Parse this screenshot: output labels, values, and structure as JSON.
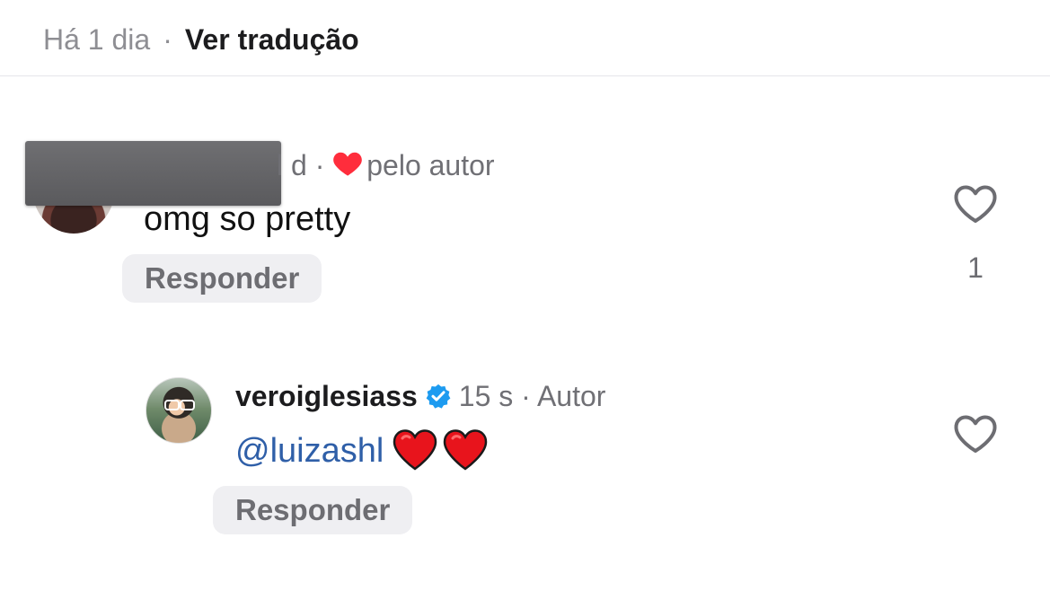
{
  "post_meta": {
    "time": "Há 1 dia",
    "separator": "·",
    "translate": "Ver tradução"
  },
  "comment1": {
    "author": "",
    "time_suffix": "l d ·",
    "liked_by_author_icon": "heart-icon",
    "liked_by_author_text": "pelo autor",
    "text": "omg so pretty",
    "reply_label": "Responder",
    "like_count": "1"
  },
  "reply": {
    "username": "veroiglesiass",
    "verified_icon": "verified-badge-icon",
    "time": "15 s",
    "separator": "·",
    "role": "Autor",
    "mention": "@luizashl",
    "emoji": "❤️ ❤️",
    "reply_label": "Responder"
  },
  "colors": {
    "heart": "#ff2d3c",
    "verified": "#1d9bf0",
    "mention": "#2f5fa8",
    "secondary_text": "#707075"
  }
}
